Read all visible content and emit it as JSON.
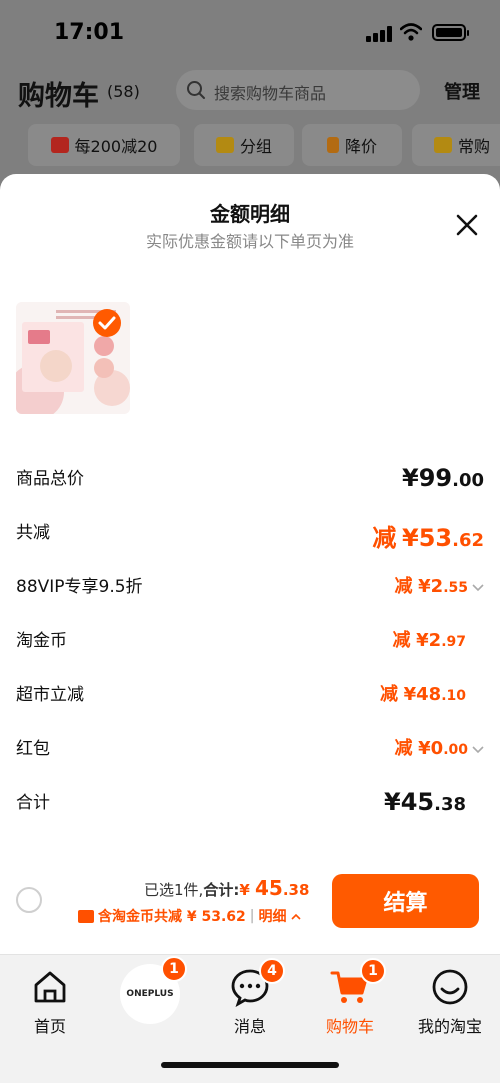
{
  "status": {
    "time": "17:01"
  },
  "header": {
    "title": "购物车",
    "count": "(58)",
    "search_placeholder": "搜索购物车商品",
    "manage_label": "管理"
  },
  "chips": [
    {
      "label": "每200减20",
      "icon": "promo-icon"
    },
    {
      "label": "分组",
      "icon": "folder-icon"
    },
    {
      "label": "降价",
      "icon": "down-arrow-icon"
    },
    {
      "label": "常购",
      "icon": "cart-icon"
    }
  ],
  "sheet": {
    "title": "金额明细",
    "subtitle": "实际优惠金额请以下单页为准",
    "rows": [
      {
        "label": "商品总价",
        "prefix": "",
        "currency": "¥",
        "int": "99",
        "dec": ".00"
      },
      {
        "label": "共减",
        "prefix": "减",
        "currency": "¥",
        "int": "53",
        "dec": ".62"
      },
      {
        "label": "88VIP专享9.5折",
        "prefix": "减",
        "currency": "¥",
        "int": "2",
        "dec": ".55"
      },
      {
        "label": "淘金币",
        "prefix": "减",
        "currency": "¥",
        "int": "2",
        "dec": ".97"
      },
      {
        "label": "超市立减",
        "prefix": "减",
        "currency": "¥",
        "int": "48",
        "dec": ".10"
      },
      {
        "label": "红包",
        "prefix": "减",
        "currency": "¥",
        "int": "0",
        "dec": ".00"
      },
      {
        "label": "合计",
        "prefix": "",
        "currency": "¥",
        "int": "45",
        "dec": ".38"
      }
    ]
  },
  "checkout": {
    "selected_text": "已选1件,",
    "total_label": "合计:",
    "total_currency": "¥",
    "total_int": "45",
    "total_dec": ".38",
    "coin_text": "含淘金币共减 ¥ 53.62",
    "separator": "|",
    "detail_label": "明细",
    "pay_label": "结算"
  },
  "tabs": [
    {
      "label": "首页",
      "icon": "home-icon",
      "badge": ""
    },
    {
      "label": "",
      "icon": "oneplus-logo",
      "badge": "1",
      "logo_text": "ONEPLUS"
    },
    {
      "label": "消息",
      "icon": "message-icon",
      "badge": "4"
    },
    {
      "label": "购物车",
      "icon": "cart-icon",
      "badge": "1",
      "active": true
    },
    {
      "label": "我的淘宝",
      "icon": "profile-icon",
      "badge": ""
    }
  ],
  "colors": {
    "accent": "#ff5000",
    "pay_button": "#ff5a00"
  }
}
